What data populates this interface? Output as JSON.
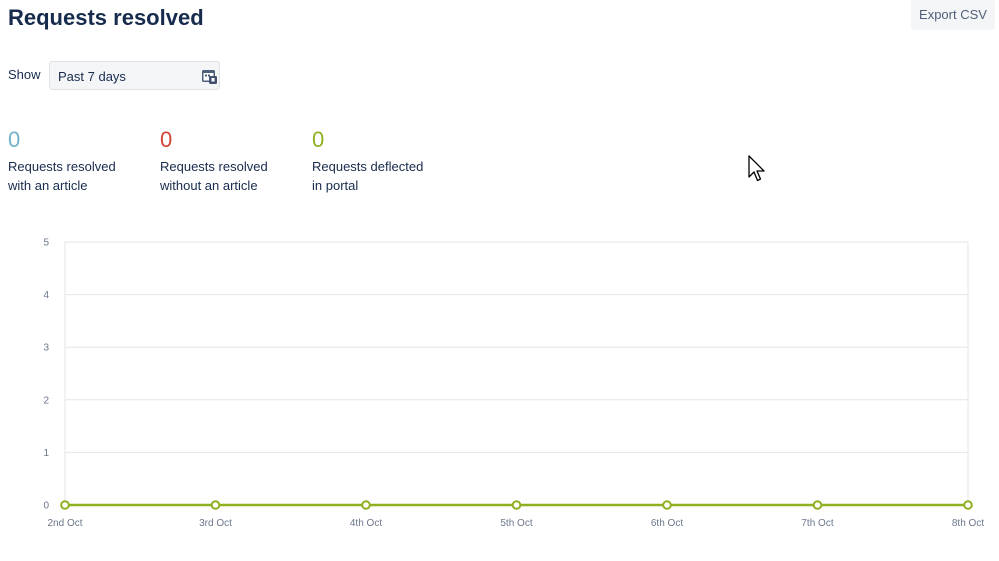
{
  "header": {
    "title": "Requests resolved",
    "export_label": "Export CSV"
  },
  "filter": {
    "show_label": "Show",
    "period_value": "Past 7 days",
    "icon": "calendar-icon"
  },
  "stats": [
    {
      "value": "0",
      "label": "Requests resolved with an article",
      "color": "#72b3c9"
    },
    {
      "value": "0",
      "label": "Requests resolved without an article",
      "color": "#d04437"
    },
    {
      "value": "0",
      "label": "Requests deflected in portal",
      "color": "#8eb021"
    }
  ],
  "chart_data": {
    "type": "line",
    "categories": [
      "2nd Oct",
      "3rd Oct",
      "4th Oct",
      "5th Oct",
      "6th Oct",
      "7th Oct",
      "8th Oct"
    ],
    "ylim": [
      0,
      5
    ],
    "yticks": [
      "0",
      "1",
      "2",
      "3",
      "4",
      "5"
    ],
    "grid": true,
    "series": [
      {
        "values": [
          0,
          0,
          0,
          0,
          0,
          0,
          0
        ],
        "color": "#8eb021"
      }
    ]
  }
}
